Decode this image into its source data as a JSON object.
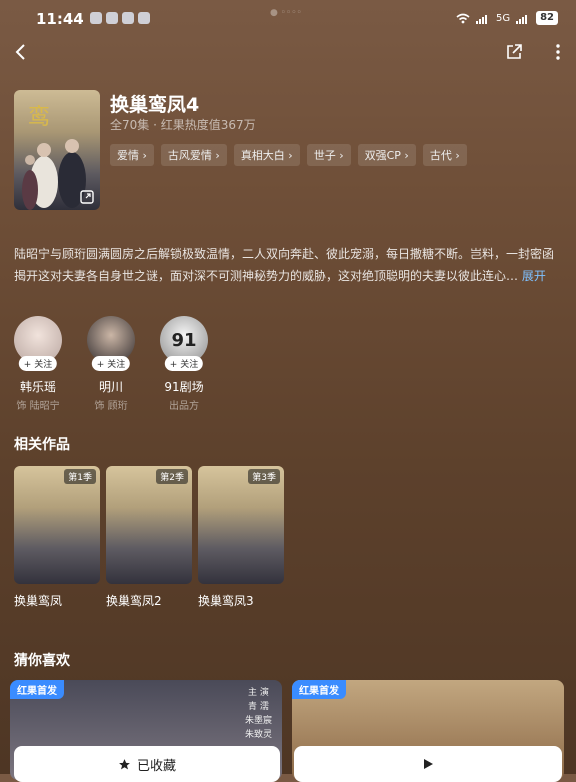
{
  "status_bar": {
    "time": "11:44",
    "battery": "82",
    "network": "5G"
  },
  "show": {
    "title": "换巢鸾凤4",
    "subtitle": "全70集 · 红果热度值367万",
    "tags": [
      "爱情 ›",
      "古风爱情 ›",
      "真相大白 ›",
      "世子 ›",
      "双强CP ›",
      "古代 ›"
    ],
    "description": "陆昭宁与顾珩圆满圆房之后解锁极致温情，二人双向奔赴、彼此宠溺，每日撒糖不断。岂料，一封密函揭开这对夫妻各自身世之谜，面对深不可测神秘势力的威胁，这对绝顶聪明的夫妻以彼此连心…",
    "expand_label": "展开"
  },
  "cast": [
    {
      "name": "韩乐瑶",
      "role": "饰 陆昭宁",
      "follow": "+ 关注",
      "avatar_icon": "person-avatar-icon"
    },
    {
      "name": "明川",
      "role": "饰 顾珩",
      "follow": "+ 关注",
      "avatar_icon": "person-avatar-icon"
    },
    {
      "name": "91剧场",
      "role": "出品方",
      "follow": "+ 关注",
      "avatar_icon": "studio-logo-icon",
      "logo_text": "91"
    }
  ],
  "related": {
    "title": "相关作品",
    "items": [
      {
        "title": "换巢鸾凤",
        "season": "第1季"
      },
      {
        "title": "换巢鸾凤2",
        "season": "第2季"
      },
      {
        "title": "换巢鸾凤3",
        "season": "第3季"
      }
    ]
  },
  "recommend": {
    "title": "猜你喜欢",
    "badge": "红果首发",
    "card1_text": [
      "主 演",
      "青 濡",
      "朱墨宸",
      "朱致灵"
    ],
    "favorite_label": "已收藏"
  },
  "colors": {
    "accent_link": "#7fc1ff",
    "badge_blue": "#3a8cff"
  }
}
